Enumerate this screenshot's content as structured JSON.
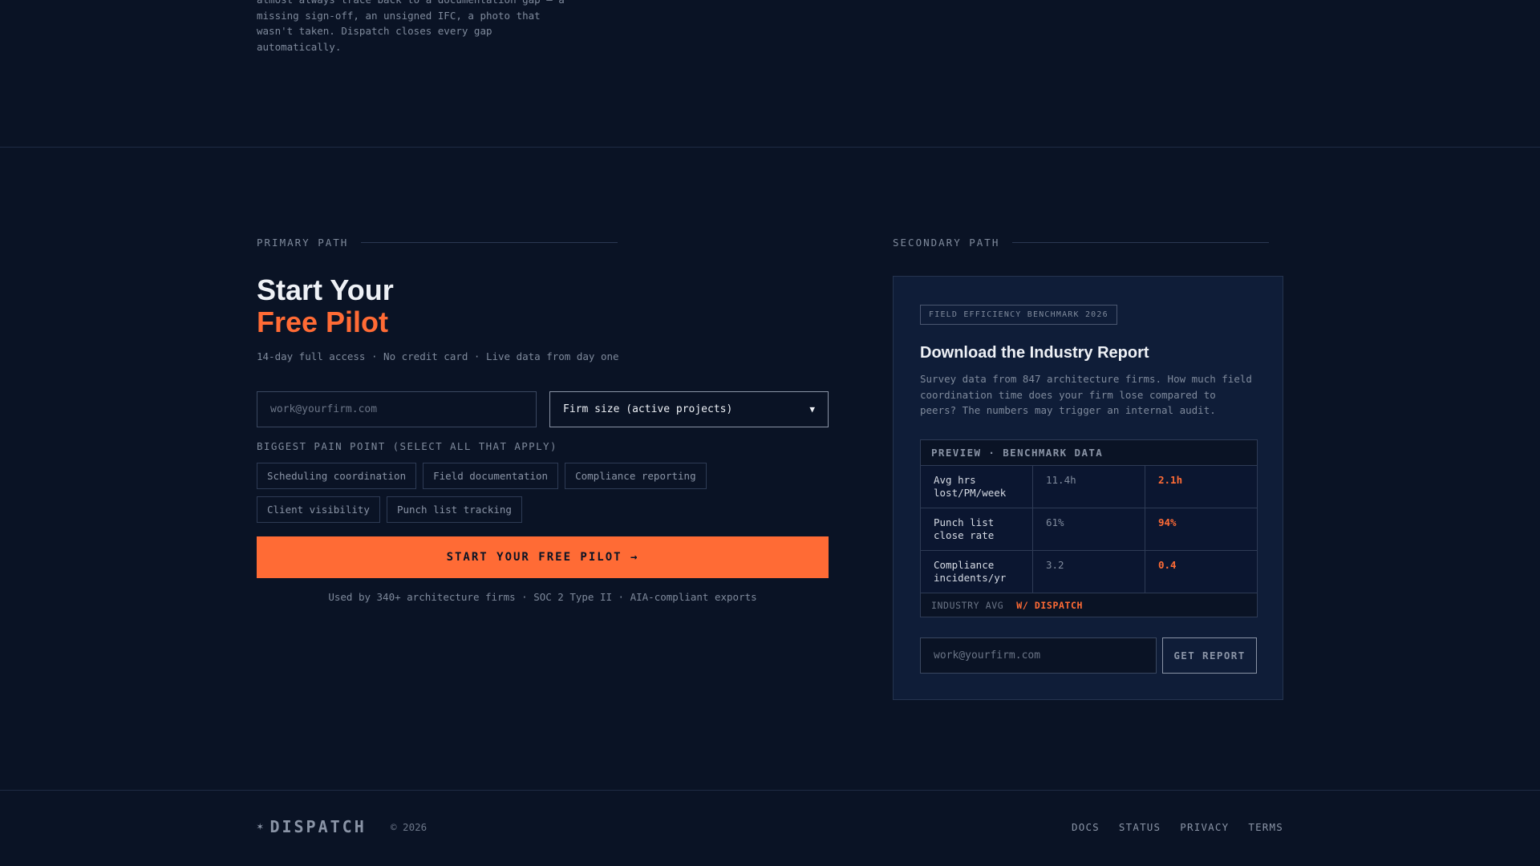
{
  "intro": {
    "text": "almost always trace back to a documentation gap — a missing sign-off, an unsigned IFC, a photo that wasn't taken. Dispatch closes every gap automatically."
  },
  "primary": {
    "label": "PRIMARY PATH",
    "headline_line1": "Start Your",
    "headline_line2": "Free Pilot",
    "subline": "14-day full access · No credit card · Live data from day one",
    "email_placeholder": "work@yourfirm.com",
    "firm_size_selected": "Firm size (active projects)",
    "pain_label": "BIGGEST PAIN POINT (SELECT ALL THAT APPLY)",
    "pain_points": [
      "Scheduling coordination",
      "Field documentation",
      "Compliance reporting",
      "Client visibility",
      "Punch list tracking"
    ],
    "cta": "START YOUR FREE PILOT →",
    "trust": "Used by 340+ architecture firms · SOC 2 Type II · AIA-compliant exports"
  },
  "secondary": {
    "label": "SECONDARY PATH",
    "badge": "FIELD EFFICIENCY BENCHMARK 2026",
    "title": "Download the Industry Report",
    "description": "Survey data from 847 architecture firms. How much field coordination time does your firm lose compared to peers? The numbers may trigger an internal audit.",
    "table_header": "PREVIEW · BENCHMARK DATA",
    "rows": [
      {
        "metric": "Avg hrs lost/PM/week",
        "industry": "11.4h",
        "dispatch": "2.1h"
      },
      {
        "metric": "Punch list close rate",
        "industry": "61%",
        "dispatch": "94%"
      },
      {
        "metric": "Compliance incidents/yr",
        "industry": "3.2",
        "dispatch": "0.4"
      }
    ],
    "legend_industry": "INDUSTRY AVG",
    "legend_dispatch": "W/ DISPATCH",
    "email_placeholder": "work@yourfirm.com",
    "button": "GET REPORT"
  },
  "footer": {
    "logo_mark": "✶",
    "logo_text": "DISPATCH",
    "copyright": "© 2026",
    "links": [
      "DOCS",
      "STATUS",
      "PRIVACY",
      "TERMS"
    ]
  },
  "colors": {
    "background": "#0a1325",
    "card": "#0f1d38",
    "accent": "#ff6b35"
  }
}
